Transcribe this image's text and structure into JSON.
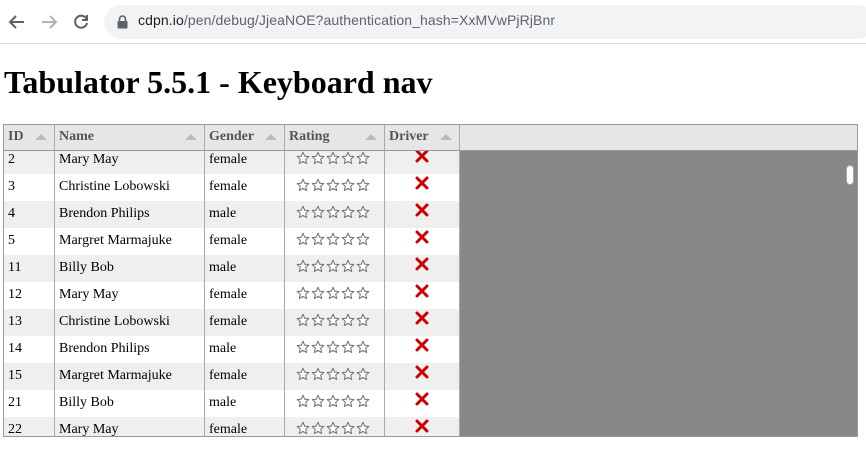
{
  "browser": {
    "url_host": "cdpn.io",
    "url_path": "/pen/debug/JjeaNOE?authentication_hash=XxMVwPjRjBnr"
  },
  "page": {
    "title": "Tabulator 5.5.1 - Keyboard nav"
  },
  "table": {
    "columns": [
      "ID",
      "Name",
      "Gender",
      "Rating",
      "Driver"
    ],
    "rows": [
      {
        "id": "2",
        "name": "Mary May",
        "gender": "female",
        "rating": 0,
        "driver": false
      },
      {
        "id": "3",
        "name": "Christine Lobowski",
        "gender": "female",
        "rating": 0,
        "driver": false
      },
      {
        "id": "4",
        "name": "Brendon Philips",
        "gender": "male",
        "rating": 0,
        "driver": false
      },
      {
        "id": "5",
        "name": "Margret Marmajuke",
        "gender": "female",
        "rating": 0,
        "driver": false
      },
      {
        "id": "11",
        "name": "Billy Bob",
        "gender": "male",
        "rating": 0,
        "driver": false
      },
      {
        "id": "12",
        "name": "Mary May",
        "gender": "female",
        "rating": 0,
        "driver": false
      },
      {
        "id": "13",
        "name": "Christine Lobowski",
        "gender": "female",
        "rating": 0,
        "driver": false
      },
      {
        "id": "14",
        "name": "Brendon Philips",
        "gender": "male",
        "rating": 0,
        "driver": false
      },
      {
        "id": "15",
        "name": "Margret Marmajuke",
        "gender": "female",
        "rating": 0,
        "driver": false
      },
      {
        "id": "21",
        "name": "Billy Bob",
        "gender": "male",
        "rating": 0,
        "driver": false
      },
      {
        "id": "22",
        "name": "Mary May",
        "gender": "female",
        "rating": 0,
        "driver": false
      }
    ],
    "star_max": 5,
    "icons": {
      "false_icon": "cross-icon",
      "star_icon": "star-outline-icon"
    },
    "colors": {
      "cross": "#cc0000",
      "header_bg": "#e6e6e6",
      "empty_area": "#888888"
    }
  }
}
